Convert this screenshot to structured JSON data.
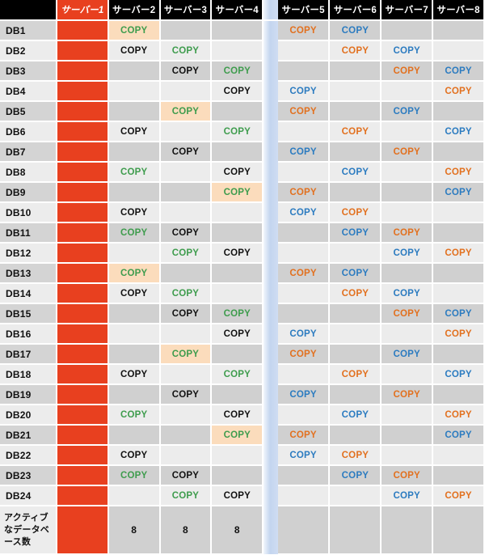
{
  "table": {
    "headers": {
      "row_label_blank": "",
      "servers": [
        "サーバー1",
        "サーバー2",
        "サーバー3",
        "サーバー4",
        "サーバー5",
        "サーバー6",
        "サーバー7",
        "サーバー8"
      ],
      "gap_label": ""
    },
    "copy_label": "COPY",
    "colors": {
      "active_server": "#E8401F",
      "highlight_cell": "#FBDCBC",
      "copy_black": "#111111",
      "copy_green": "#3E9C4D",
      "copy_orange": "#E2701E",
      "copy_blue": "#2B7BC0",
      "row_odd": "#D0D0D0",
      "row_even": "#ECECEC",
      "header_bg": "#000000",
      "gap_gradient_from": "#F2F6FC",
      "gap_gradient_to": "#C3D5EF"
    },
    "rows": [
      {
        "label": "DB1",
        "cells": [
          {
            "t": "",
            "k": "active"
          },
          {
            "t": "COPY",
            "c": "green",
            "hl": true
          },
          {
            "t": ""
          },
          {
            "t": ""
          },
          {
            "t": "COPY",
            "c": "orange"
          },
          {
            "t": "COPY",
            "c": "blue"
          },
          {
            "t": ""
          },
          {
            "t": ""
          }
        ]
      },
      {
        "label": "DB2",
        "cells": [
          {
            "t": "",
            "k": "active"
          },
          {
            "t": "COPY",
            "c": "black"
          },
          {
            "t": "COPY",
            "c": "green"
          },
          {
            "t": ""
          },
          {
            "t": ""
          },
          {
            "t": "COPY",
            "c": "orange"
          },
          {
            "t": "COPY",
            "c": "blue"
          },
          {
            "t": ""
          }
        ]
      },
      {
        "label": "DB3",
        "cells": [
          {
            "t": "",
            "k": "active"
          },
          {
            "t": ""
          },
          {
            "t": "COPY",
            "c": "black"
          },
          {
            "t": "COPY",
            "c": "green"
          },
          {
            "t": ""
          },
          {
            "t": ""
          },
          {
            "t": "COPY",
            "c": "orange"
          },
          {
            "t": "COPY",
            "c": "blue"
          }
        ]
      },
      {
        "label": "DB4",
        "cells": [
          {
            "t": "",
            "k": "active"
          },
          {
            "t": ""
          },
          {
            "t": ""
          },
          {
            "t": "COPY",
            "c": "black"
          },
          {
            "t": "COPY",
            "c": "blue"
          },
          {
            "t": ""
          },
          {
            "t": ""
          },
          {
            "t": "COPY",
            "c": "orange"
          }
        ]
      },
      {
        "label": "DB5",
        "cells": [
          {
            "t": "",
            "k": "active"
          },
          {
            "t": ""
          },
          {
            "t": "COPY",
            "c": "green",
            "hl": true
          },
          {
            "t": ""
          },
          {
            "t": "COPY",
            "c": "orange"
          },
          {
            "t": ""
          },
          {
            "t": "COPY",
            "c": "blue"
          },
          {
            "t": ""
          }
        ]
      },
      {
        "label": "DB6",
        "cells": [
          {
            "t": "",
            "k": "active"
          },
          {
            "t": "COPY",
            "c": "black"
          },
          {
            "t": ""
          },
          {
            "t": "COPY",
            "c": "green"
          },
          {
            "t": ""
          },
          {
            "t": "COPY",
            "c": "orange"
          },
          {
            "t": ""
          },
          {
            "t": "COPY",
            "c": "blue"
          }
        ]
      },
      {
        "label": "DB7",
        "cells": [
          {
            "t": "",
            "k": "active"
          },
          {
            "t": ""
          },
          {
            "t": "COPY",
            "c": "black"
          },
          {
            "t": ""
          },
          {
            "t": "COPY",
            "c": "blue"
          },
          {
            "t": ""
          },
          {
            "t": "COPY",
            "c": "orange"
          },
          {
            "t": ""
          }
        ]
      },
      {
        "label": "DB8",
        "cells": [
          {
            "t": "",
            "k": "active"
          },
          {
            "t": "COPY",
            "c": "green"
          },
          {
            "t": ""
          },
          {
            "t": "COPY",
            "c": "black"
          },
          {
            "t": ""
          },
          {
            "t": "COPY",
            "c": "blue"
          },
          {
            "t": ""
          },
          {
            "t": "COPY",
            "c": "orange"
          }
        ]
      },
      {
        "label": "DB9",
        "cells": [
          {
            "t": "",
            "k": "active"
          },
          {
            "t": ""
          },
          {
            "t": ""
          },
          {
            "t": "COPY",
            "c": "green",
            "hl": true
          },
          {
            "t": "COPY",
            "c": "orange"
          },
          {
            "t": ""
          },
          {
            "t": ""
          },
          {
            "t": "COPY",
            "c": "blue"
          }
        ]
      },
      {
        "label": "DB10",
        "cells": [
          {
            "t": "",
            "k": "active"
          },
          {
            "t": "COPY",
            "c": "black"
          },
          {
            "t": ""
          },
          {
            "t": ""
          },
          {
            "t": "COPY",
            "c": "blue"
          },
          {
            "t": "COPY",
            "c": "orange"
          },
          {
            "t": ""
          },
          {
            "t": ""
          }
        ]
      },
      {
        "label": "DB11",
        "cells": [
          {
            "t": "",
            "k": "active"
          },
          {
            "t": "COPY",
            "c": "green"
          },
          {
            "t": "COPY",
            "c": "black"
          },
          {
            "t": ""
          },
          {
            "t": ""
          },
          {
            "t": "COPY",
            "c": "blue"
          },
          {
            "t": "COPY",
            "c": "orange"
          },
          {
            "t": ""
          }
        ]
      },
      {
        "label": "DB12",
        "cells": [
          {
            "t": "",
            "k": "active"
          },
          {
            "t": ""
          },
          {
            "t": "COPY",
            "c": "green"
          },
          {
            "t": "COPY",
            "c": "black"
          },
          {
            "t": ""
          },
          {
            "t": ""
          },
          {
            "t": "COPY",
            "c": "blue"
          },
          {
            "t": "COPY",
            "c": "orange"
          }
        ]
      },
      {
        "label": "DB13",
        "cells": [
          {
            "t": "",
            "k": "active"
          },
          {
            "t": "COPY",
            "c": "green",
            "hl": true
          },
          {
            "t": ""
          },
          {
            "t": ""
          },
          {
            "t": "COPY",
            "c": "orange"
          },
          {
            "t": "COPY",
            "c": "blue"
          },
          {
            "t": ""
          },
          {
            "t": ""
          }
        ]
      },
      {
        "label": "DB14",
        "cells": [
          {
            "t": "",
            "k": "active"
          },
          {
            "t": "COPY",
            "c": "black"
          },
          {
            "t": "COPY",
            "c": "green"
          },
          {
            "t": ""
          },
          {
            "t": ""
          },
          {
            "t": "COPY",
            "c": "orange"
          },
          {
            "t": "COPY",
            "c": "blue"
          },
          {
            "t": ""
          }
        ]
      },
      {
        "label": "DB15",
        "cells": [
          {
            "t": "",
            "k": "active"
          },
          {
            "t": ""
          },
          {
            "t": "COPY",
            "c": "black"
          },
          {
            "t": "COPY",
            "c": "green"
          },
          {
            "t": ""
          },
          {
            "t": ""
          },
          {
            "t": "COPY",
            "c": "orange"
          },
          {
            "t": "COPY",
            "c": "blue"
          }
        ]
      },
      {
        "label": "DB16",
        "cells": [
          {
            "t": "",
            "k": "active"
          },
          {
            "t": ""
          },
          {
            "t": ""
          },
          {
            "t": "COPY",
            "c": "black"
          },
          {
            "t": "COPY",
            "c": "blue"
          },
          {
            "t": ""
          },
          {
            "t": ""
          },
          {
            "t": "COPY",
            "c": "orange"
          }
        ]
      },
      {
        "label": "DB17",
        "cells": [
          {
            "t": "",
            "k": "active"
          },
          {
            "t": ""
          },
          {
            "t": "COPY",
            "c": "green",
            "hl": true
          },
          {
            "t": ""
          },
          {
            "t": "COPY",
            "c": "orange"
          },
          {
            "t": ""
          },
          {
            "t": "COPY",
            "c": "blue"
          },
          {
            "t": ""
          }
        ]
      },
      {
        "label": "DB18",
        "cells": [
          {
            "t": "",
            "k": "active"
          },
          {
            "t": "COPY",
            "c": "black"
          },
          {
            "t": ""
          },
          {
            "t": "COPY",
            "c": "green"
          },
          {
            "t": ""
          },
          {
            "t": "COPY",
            "c": "orange"
          },
          {
            "t": ""
          },
          {
            "t": "COPY",
            "c": "blue"
          }
        ]
      },
      {
        "label": "DB19",
        "cells": [
          {
            "t": "",
            "k": "active"
          },
          {
            "t": ""
          },
          {
            "t": "COPY",
            "c": "black"
          },
          {
            "t": ""
          },
          {
            "t": "COPY",
            "c": "blue"
          },
          {
            "t": ""
          },
          {
            "t": "COPY",
            "c": "orange"
          },
          {
            "t": ""
          }
        ]
      },
      {
        "label": "DB20",
        "cells": [
          {
            "t": "",
            "k": "active"
          },
          {
            "t": "COPY",
            "c": "green"
          },
          {
            "t": ""
          },
          {
            "t": "COPY",
            "c": "black"
          },
          {
            "t": ""
          },
          {
            "t": "COPY",
            "c": "blue"
          },
          {
            "t": ""
          },
          {
            "t": "COPY",
            "c": "orange"
          }
        ]
      },
      {
        "label": "DB21",
        "cells": [
          {
            "t": "",
            "k": "active"
          },
          {
            "t": ""
          },
          {
            "t": ""
          },
          {
            "t": "COPY",
            "c": "green",
            "hl": true
          },
          {
            "t": "COPY",
            "c": "orange"
          },
          {
            "t": ""
          },
          {
            "t": ""
          },
          {
            "t": "COPY",
            "c": "blue"
          }
        ]
      },
      {
        "label": "DB22",
        "cells": [
          {
            "t": "",
            "k": "active"
          },
          {
            "t": "COPY",
            "c": "black"
          },
          {
            "t": ""
          },
          {
            "t": ""
          },
          {
            "t": "COPY",
            "c": "blue"
          },
          {
            "t": "COPY",
            "c": "orange"
          },
          {
            "t": ""
          },
          {
            "t": ""
          }
        ]
      },
      {
        "label": "DB23",
        "cells": [
          {
            "t": "",
            "k": "active"
          },
          {
            "t": "COPY",
            "c": "green"
          },
          {
            "t": "COPY",
            "c": "black"
          },
          {
            "t": ""
          },
          {
            "t": ""
          },
          {
            "t": "COPY",
            "c": "blue"
          },
          {
            "t": "COPY",
            "c": "orange"
          },
          {
            "t": ""
          }
        ]
      },
      {
        "label": "DB24",
        "cells": [
          {
            "t": "",
            "k": "active"
          },
          {
            "t": ""
          },
          {
            "t": "COPY",
            "c": "green"
          },
          {
            "t": "COPY",
            "c": "black"
          },
          {
            "t": ""
          },
          {
            "t": ""
          },
          {
            "t": "COPY",
            "c": "blue"
          },
          {
            "t": "COPY",
            "c": "orange"
          }
        ]
      }
    ],
    "footer": {
      "label": "アクティブなデータベース数",
      "values": [
        "",
        "8",
        "8",
        "8",
        "",
        "",
        "",
        ""
      ]
    }
  }
}
